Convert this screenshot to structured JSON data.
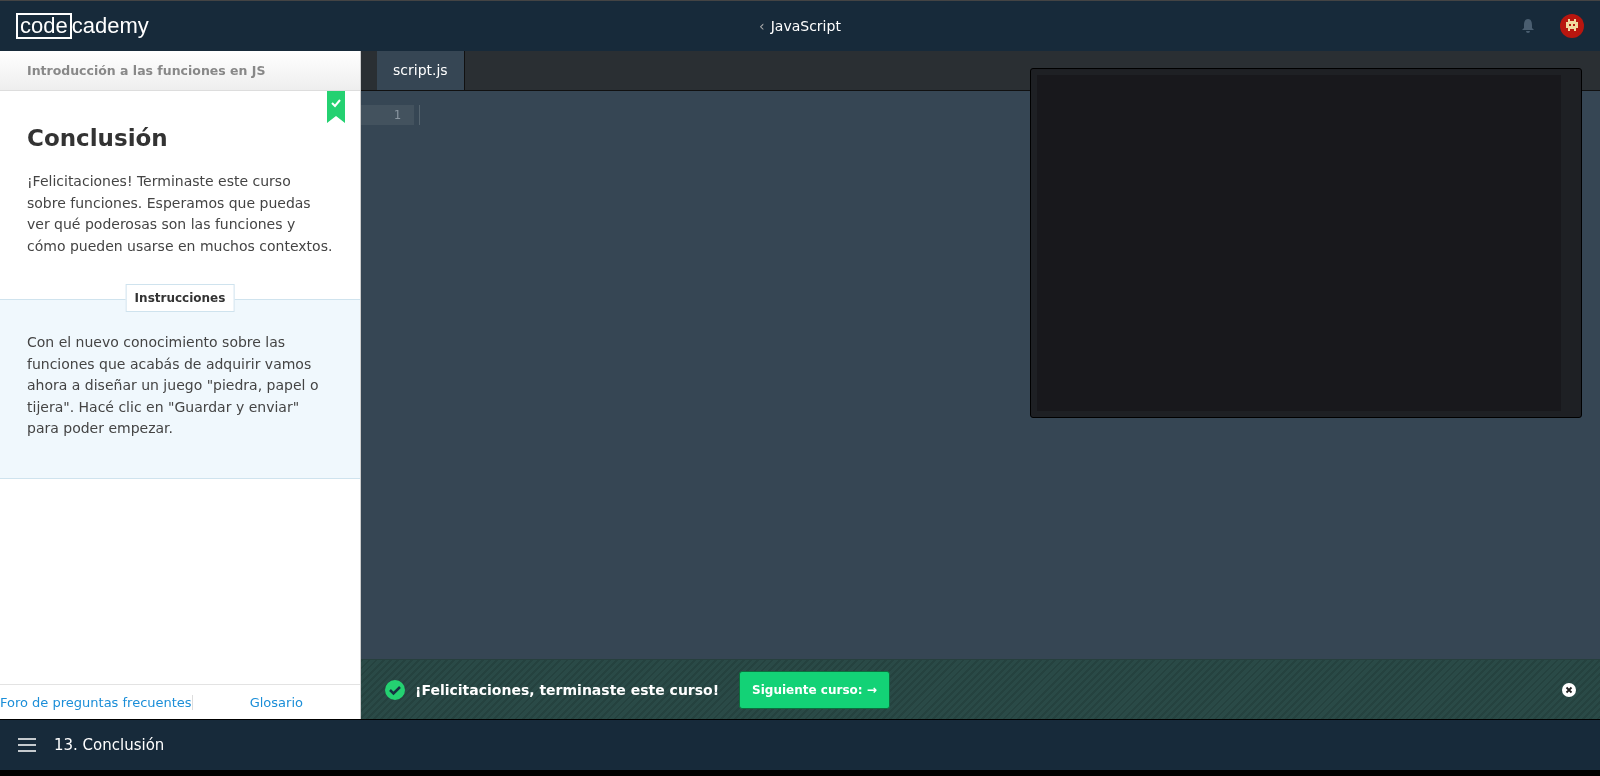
{
  "header": {
    "logo": {
      "boxed": "code",
      "rest": "cademy"
    },
    "back_icon": "‹",
    "course": "JavaScript"
  },
  "lesson": {
    "unit": "Introducción a las funciones en JS",
    "completed": true,
    "title": "Conclusión",
    "body": "¡Felicitaciones! Terminaste este curso sobre funciones. Esperamos que puedas ver qué poderosas son las funciones y cómo pueden usarse en muchos contextos.",
    "instructions_label": "Instrucciones",
    "instructions": "Con el nuevo conocimiento sobre las funciones que acabás de adquirir vamos ahora a diseñar un juego \"piedra, papel o tijera\". Hacé clic en \"Guardar y enviar\" para poder empezar."
  },
  "footer_links": [
    "Foro de preguntas frecuentes",
    "Glosario"
  ],
  "editor": {
    "tabs": [
      {
        "label": "script.js",
        "selected": true
      }
    ],
    "line_numbers": [
      "1"
    ]
  },
  "banner": {
    "message": "¡Felicitaciones, terminaste este curso!",
    "button": "Siguiente curso: →"
  },
  "bottom_bar": {
    "title": "13. Conclusión"
  }
}
